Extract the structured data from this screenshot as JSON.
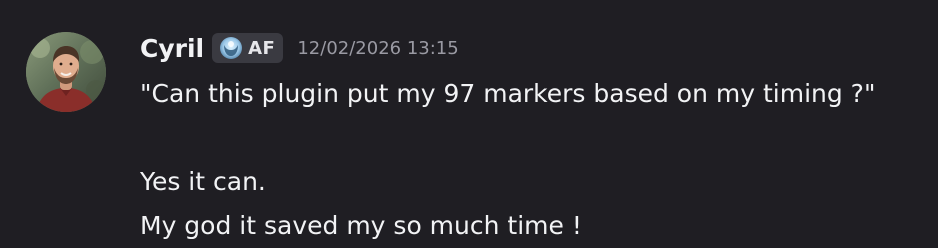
{
  "message": {
    "author": "Cyril",
    "tag": {
      "icon": "guild-tag-icon",
      "text": "AF"
    },
    "timestamp": "12/02/2026 13:15",
    "lines": [
      "\"Can this plugin put my 97 markers based on my timing ?\"",
      "",
      "Yes it can.",
      "My god it saved my so much time !"
    ]
  },
  "colors": {
    "background": "#1f1e23",
    "text": "#f2f3f5",
    "timestamp": "#9a9aa3",
    "tag_bg": "#3a3a41"
  }
}
